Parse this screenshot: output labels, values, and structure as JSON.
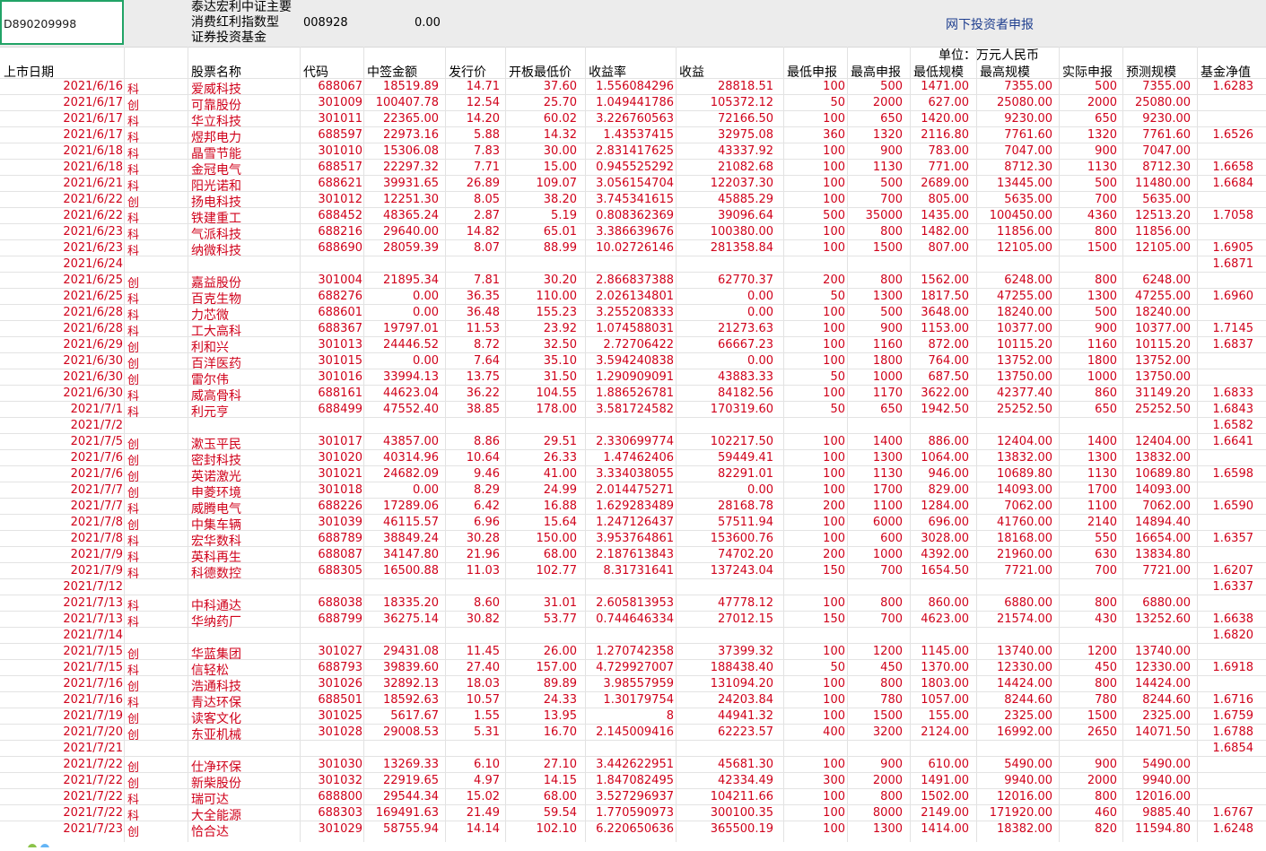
{
  "cell_ref": "D890209998",
  "fund": {
    "line1": "泰达宏利中证主要",
    "line2": "消费红利指数型",
    "line3": "证券投资基金",
    "code": "008928",
    "value": "0.00"
  },
  "online_label": "网下投资者申报",
  "unit_label": "单位：万元人民币",
  "headers": {
    "date": "上市日期",
    "name": "股票名称",
    "code": "代码",
    "amt": "中签金额",
    "ipo": "发行价",
    "low": "开板最低价",
    "rate": "收益率",
    "inc": "收益",
    "minb": "最低申报",
    "maxb": "最高申报",
    "mins": "最低规模",
    "maxs": "最高规模",
    "act": "实际申报",
    "pred": "预测规模",
    "nav": "基金净值"
  },
  "rows": [
    [
      "2021/6/16",
      "科",
      "爱威科技",
      "688067",
      "18519.89",
      "14.71",
      "37.60",
      "1.556084296",
      "28818.51",
      "100",
      "500",
      "1471.00",
      "7355.00",
      "500",
      "7355.00",
      "1.6283"
    ],
    [
      "2021/6/17",
      "创",
      "可靠股份",
      "301009",
      "100407.78",
      "12.54",
      "25.70",
      "1.049441786",
      "105372.12",
      "50",
      "2000",
      "627.00",
      "25080.00",
      "2000",
      "25080.00",
      ""
    ],
    [
      "2021/6/17",
      "科",
      "华立科技",
      "301011",
      "22365.00",
      "14.20",
      "60.02",
      "3.226760563",
      "72166.50",
      "100",
      "650",
      "1420.00",
      "9230.00",
      "650",
      "9230.00",
      ""
    ],
    [
      "2021/6/17",
      "科",
      "煜邦电力",
      "688597",
      "22973.16",
      "5.88",
      "14.32",
      "1.43537415",
      "32975.08",
      "360",
      "1320",
      "2116.80",
      "7761.60",
      "1320",
      "7761.60",
      "1.6526"
    ],
    [
      "2021/6/18",
      "科",
      "晶雪节能",
      "301010",
      "15306.08",
      "7.83",
      "30.00",
      "2.831417625",
      "43337.92",
      "100",
      "900",
      "783.00",
      "7047.00",
      "900",
      "7047.00",
      ""
    ],
    [
      "2021/6/18",
      "科",
      "金冠电气",
      "688517",
      "22297.32",
      "7.71",
      "15.00",
      "0.945525292",
      "21082.68",
      "100",
      "1130",
      "771.00",
      "8712.30",
      "1130",
      "8712.30",
      "1.6658"
    ],
    [
      "2021/6/21",
      "科",
      "阳光诺和",
      "688621",
      "39931.65",
      "26.89",
      "109.07",
      "3.056154704",
      "122037.30",
      "100",
      "500",
      "2689.00",
      "13445.00",
      "500",
      "11480.00",
      "1.6684"
    ],
    [
      "2021/6/22",
      "创",
      "扬电科技",
      "301012",
      "12251.30",
      "8.05",
      "38.20",
      "3.745341615",
      "45885.29",
      "100",
      "700",
      "805.00",
      "5635.00",
      "700",
      "5635.00",
      ""
    ],
    [
      "2021/6/22",
      "科",
      "铁建重工",
      "688452",
      "48365.24",
      "2.87",
      "5.19",
      "0.808362369",
      "39096.64",
      "500",
      "35000",
      "1435.00",
      "100450.00",
      "4360",
      "12513.20",
      "1.7058"
    ],
    [
      "2021/6/23",
      "科",
      "气派科技",
      "688216",
      "29640.00",
      "14.82",
      "65.01",
      "3.386639676",
      "100380.00",
      "100",
      "800",
      "1482.00",
      "11856.00",
      "800",
      "11856.00",
      ""
    ],
    [
      "2021/6/23",
      "科",
      "纳微科技",
      "688690",
      "28059.39",
      "8.07",
      "88.99",
      "10.02726146",
      "281358.84",
      "100",
      "1500",
      "807.00",
      "12105.00",
      "1500",
      "12105.00",
      "1.6905"
    ],
    [
      "2021/6/24",
      "",
      "",
      "",
      "",
      "",
      "",
      "",
      "",
      "",
      "",
      "",
      "",
      "",
      "",
      "1.6871"
    ],
    [
      "2021/6/25",
      "创",
      "嘉益股份",
      "301004",
      "21895.34",
      "7.81",
      "30.20",
      "2.866837388",
      "62770.37",
      "200",
      "800",
      "1562.00",
      "6248.00",
      "800",
      "6248.00",
      ""
    ],
    [
      "2021/6/25",
      "科",
      "百克生物",
      "688276",
      "0.00",
      "36.35",
      "110.00",
      "2.026134801",
      "0.00",
      "50",
      "1300",
      "1817.50",
      "47255.00",
      "1300",
      "47255.00",
      "1.6960"
    ],
    [
      "2021/6/28",
      "科",
      "力芯微",
      "688601",
      "0.00",
      "36.48",
      "155.23",
      "3.255208333",
      "0.00",
      "100",
      "500",
      "3648.00",
      "18240.00",
      "500",
      "18240.00",
      ""
    ],
    [
      "2021/6/28",
      "科",
      "工大高科",
      "688367",
      "19797.01",
      "11.53",
      "23.92",
      "1.074588031",
      "21273.63",
      "100",
      "900",
      "1153.00",
      "10377.00",
      "900",
      "10377.00",
      "1.7145"
    ],
    [
      "2021/6/29",
      "创",
      "利和兴",
      "301013",
      "24446.52",
      "8.72",
      "32.50",
      "2.72706422",
      "66667.23",
      "100",
      "1160",
      "872.00",
      "10115.20",
      "1160",
      "10115.20",
      "1.6837"
    ],
    [
      "2021/6/30",
      "创",
      "百洋医药",
      "301015",
      "0.00",
      "7.64",
      "35.10",
      "3.594240838",
      "0.00",
      "100",
      "1800",
      "764.00",
      "13752.00",
      "1800",
      "13752.00",
      ""
    ],
    [
      "2021/6/30",
      "创",
      "雷尔伟",
      "301016",
      "33994.13",
      "13.75",
      "31.50",
      "1.290909091",
      "43883.33",
      "50",
      "1000",
      "687.50",
      "13750.00",
      "1000",
      "13750.00",
      ""
    ],
    [
      "2021/6/30",
      "科",
      "威高骨科",
      "688161",
      "44623.04",
      "36.22",
      "104.55",
      "1.886526781",
      "84182.56",
      "100",
      "1170",
      "3622.00",
      "42377.40",
      "860",
      "31149.20",
      "1.6833"
    ],
    [
      "2021/7/1",
      "科",
      "利元亨",
      "688499",
      "47552.40",
      "38.85",
      "178.00",
      "3.581724582",
      "170319.60",
      "50",
      "650",
      "1942.50",
      "25252.50",
      "650",
      "25252.50",
      "1.6843"
    ],
    [
      "2021/7/2",
      "",
      "",
      "",
      "",
      "",
      "",
      "",
      "",
      "",
      "",
      "",
      "",
      "",
      "",
      "1.6582"
    ],
    [
      "2021/7/5",
      "创",
      "漱玉平民",
      "301017",
      "43857.00",
      "8.86",
      "29.51",
      "2.330699774",
      "102217.50",
      "100",
      "1400",
      "886.00",
      "12404.00",
      "1400",
      "12404.00",
      "1.6641"
    ],
    [
      "2021/7/6",
      "创",
      "密封科技",
      "301020",
      "40314.96",
      "10.64",
      "26.33",
      "1.47462406",
      "59449.41",
      "100",
      "1300",
      "1064.00",
      "13832.00",
      "1300",
      "13832.00",
      ""
    ],
    [
      "2021/7/6",
      "创",
      "英诺激光",
      "301021",
      "24682.09",
      "9.46",
      "41.00",
      "3.334038055",
      "82291.01",
      "100",
      "1130",
      "946.00",
      "10689.80",
      "1130",
      "10689.80",
      "1.6598"
    ],
    [
      "2021/7/7",
      "创",
      "申菱环境",
      "301018",
      "0.00",
      "8.29",
      "24.99",
      "2.014475271",
      "0.00",
      "100",
      "1700",
      "829.00",
      "14093.00",
      "1700",
      "14093.00",
      ""
    ],
    [
      "2021/7/7",
      "科",
      "威腾电气",
      "688226",
      "17289.06",
      "6.42",
      "16.88",
      "1.629283489",
      "28168.78",
      "200",
      "1100",
      "1284.00",
      "7062.00",
      "1100",
      "7062.00",
      "1.6590"
    ],
    [
      "2021/7/8",
      "创",
      "中集车辆",
      "301039",
      "46115.57",
      "6.96",
      "15.64",
      "1.247126437",
      "57511.94",
      "100",
      "6000",
      "696.00",
      "41760.00",
      "2140",
      "14894.40",
      ""
    ],
    [
      "2021/7/8",
      "科",
      "宏华数科",
      "688789",
      "38849.24",
      "30.28",
      "150.00",
      "3.953764861",
      "153600.76",
      "100",
      "600",
      "3028.00",
      "18168.00",
      "550",
      "16654.00",
      "1.6357"
    ],
    [
      "2021/7/9",
      "科",
      "英科再生",
      "688087",
      "34147.80",
      "21.96",
      "68.00",
      "2.187613843",
      "74702.20",
      "200",
      "1000",
      "4392.00",
      "21960.00",
      "630",
      "13834.80",
      ""
    ],
    [
      "2021/7/9",
      "科",
      "科德数控",
      "688305",
      "16500.88",
      "11.03",
      "102.77",
      "8.31731641",
      "137243.04",
      "150",
      "700",
      "1654.50",
      "7721.00",
      "700",
      "7721.00",
      "1.6207"
    ],
    [
      "2021/7/12",
      "",
      "",
      "",
      "",
      "",
      "",
      "",
      "",
      "",
      "",
      "",
      "",
      "",
      "",
      "1.6337"
    ],
    [
      "2021/7/13",
      "科",
      "中科通达",
      "688038",
      "18335.20",
      "8.60",
      "31.01",
      "2.605813953",
      "47778.12",
      "100",
      "800",
      "860.00",
      "6880.00",
      "800",
      "6880.00",
      ""
    ],
    [
      "2021/7/13",
      "科",
      "华纳药厂",
      "688799",
      "36275.14",
      "30.82",
      "53.77",
      "0.744646334",
      "27012.15",
      "150",
      "700",
      "4623.00",
      "21574.00",
      "430",
      "13252.60",
      "1.6638"
    ],
    [
      "2021/7/14",
      "",
      "",
      "",
      "",
      "",
      "",
      "",
      "",
      "",
      "",
      "",
      "",
      "",
      "",
      "1.6820"
    ],
    [
      "2021/7/15",
      "创",
      "华蓝集团",
      "301027",
      "29431.08",
      "11.45",
      "26.00",
      "1.270742358",
      "37399.32",
      "100",
      "1200",
      "1145.00",
      "13740.00",
      "1200",
      "13740.00",
      ""
    ],
    [
      "2021/7/15",
      "科",
      "信轻松",
      "688793",
      "39839.60",
      "27.40",
      "157.00",
      "4.729927007",
      "188438.40",
      "50",
      "450",
      "1370.00",
      "12330.00",
      "450",
      "12330.00",
      "1.6918"
    ],
    [
      "2021/7/16",
      "创",
      "浩通科技",
      "301026",
      "32892.13",
      "18.03",
      "89.89",
      "3.98557959",
      "131094.20",
      "100",
      "800",
      "1803.00",
      "14424.00",
      "800",
      "14424.00",
      ""
    ],
    [
      "2021/7/16",
      "科",
      "青达环保",
      "688501",
      "18592.63",
      "10.57",
      "24.33",
      "1.30179754",
      "24203.84",
      "100",
      "780",
      "1057.00",
      "8244.60",
      "780",
      "8244.60",
      "1.6716"
    ],
    [
      "2021/7/19",
      "创",
      "读客文化",
      "301025",
      "5617.67",
      "1.55",
      "13.95",
      "8",
      "44941.32",
      "100",
      "1500",
      "155.00",
      "2325.00",
      "1500",
      "2325.00",
      "1.6759"
    ],
    [
      "2021/7/20",
      "创",
      "东亚机械",
      "301028",
      "29008.53",
      "5.31",
      "16.70",
      "2.145009416",
      "62223.57",
      "400",
      "3200",
      "2124.00",
      "16992.00",
      "2650",
      "14071.50",
      "1.6788"
    ],
    [
      "2021/7/21",
      "",
      "",
      "",
      "",
      "",
      "",
      "",
      "",
      "",
      "",
      "",
      "",
      "",
      "",
      "1.6854"
    ],
    [
      "2021/7/22",
      "创",
      "仕净环保",
      "301030",
      "13269.33",
      "6.10",
      "27.10",
      "3.442622951",
      "45681.30",
      "100",
      "900",
      "610.00",
      "5490.00",
      "900",
      "5490.00",
      ""
    ],
    [
      "2021/7/22",
      "创",
      "新柴股份",
      "301032",
      "22919.65",
      "4.97",
      "14.15",
      "1.847082495",
      "42334.49",
      "300",
      "2000",
      "1491.00",
      "9940.00",
      "2000",
      "9940.00",
      ""
    ],
    [
      "2021/7/22",
      "科",
      "瑞可达",
      "688800",
      "29544.34",
      "15.02",
      "68.00",
      "3.527296937",
      "104211.66",
      "100",
      "800",
      "1502.00",
      "12016.00",
      "800",
      "12016.00",
      ""
    ],
    [
      "2021/7/22",
      "科",
      "大全能源",
      "688303",
      "169491.63",
      "21.49",
      "59.54",
      "1.770590973",
      "300100.35",
      "100",
      "8000",
      "2149.00",
      "171920.00",
      "460",
      "9885.40",
      "1.6767"
    ],
    [
      "2021/7/23",
      "创",
      "恰合达",
      "301029",
      "58755.94",
      "14.14",
      "102.10",
      "6.220650636",
      "365500.19",
      "100",
      "1300",
      "1414.00",
      "18382.00",
      "820",
      "11594.80",
      "1.6248"
    ]
  ]
}
